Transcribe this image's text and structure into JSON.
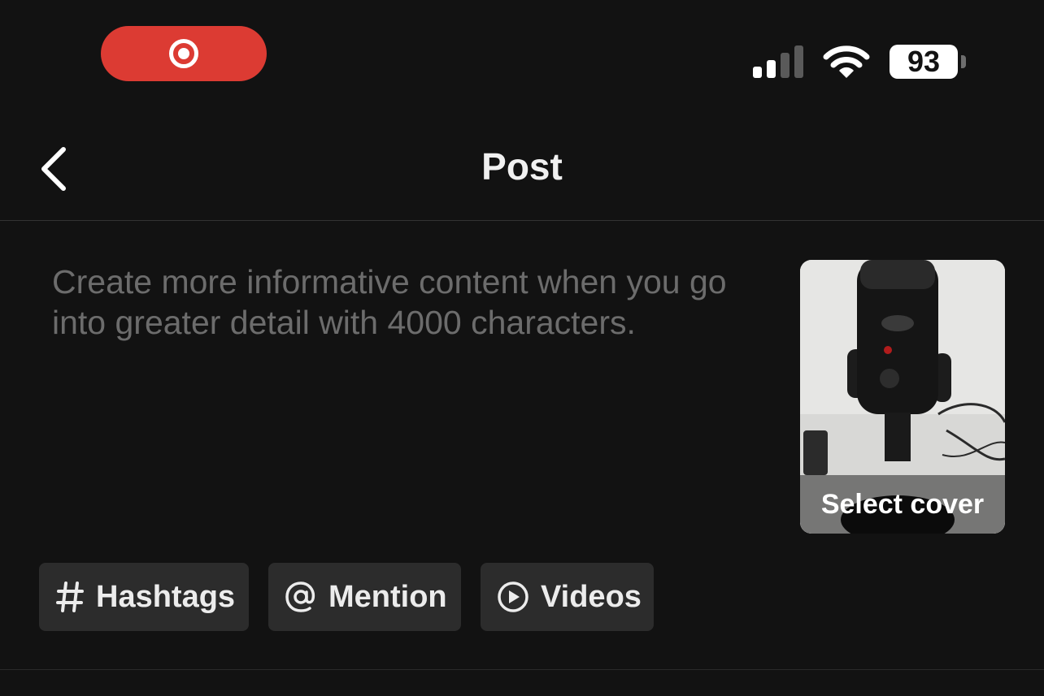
{
  "status_bar": {
    "battery_level": "93",
    "signal_bars_active": 2,
    "signal_bars_total": 4,
    "recording_indicator_color": "#dc3b33"
  },
  "header": {
    "title": "Post",
    "back_icon": "chevron-left-icon"
  },
  "editor": {
    "placeholder": "Create more informative content when you go into greater detail with 4000 characters."
  },
  "cover": {
    "label": "Select cover"
  },
  "chips": [
    {
      "icon": "hashtag-icon",
      "label": "Hashtags"
    },
    {
      "icon": "at-icon",
      "label": "Mention"
    },
    {
      "icon": "play-circle-icon",
      "label": "Videos"
    }
  ],
  "colors": {
    "background": "#121212",
    "chip_background": "#2c2c2c",
    "placeholder_text": "#6c6c6c"
  }
}
